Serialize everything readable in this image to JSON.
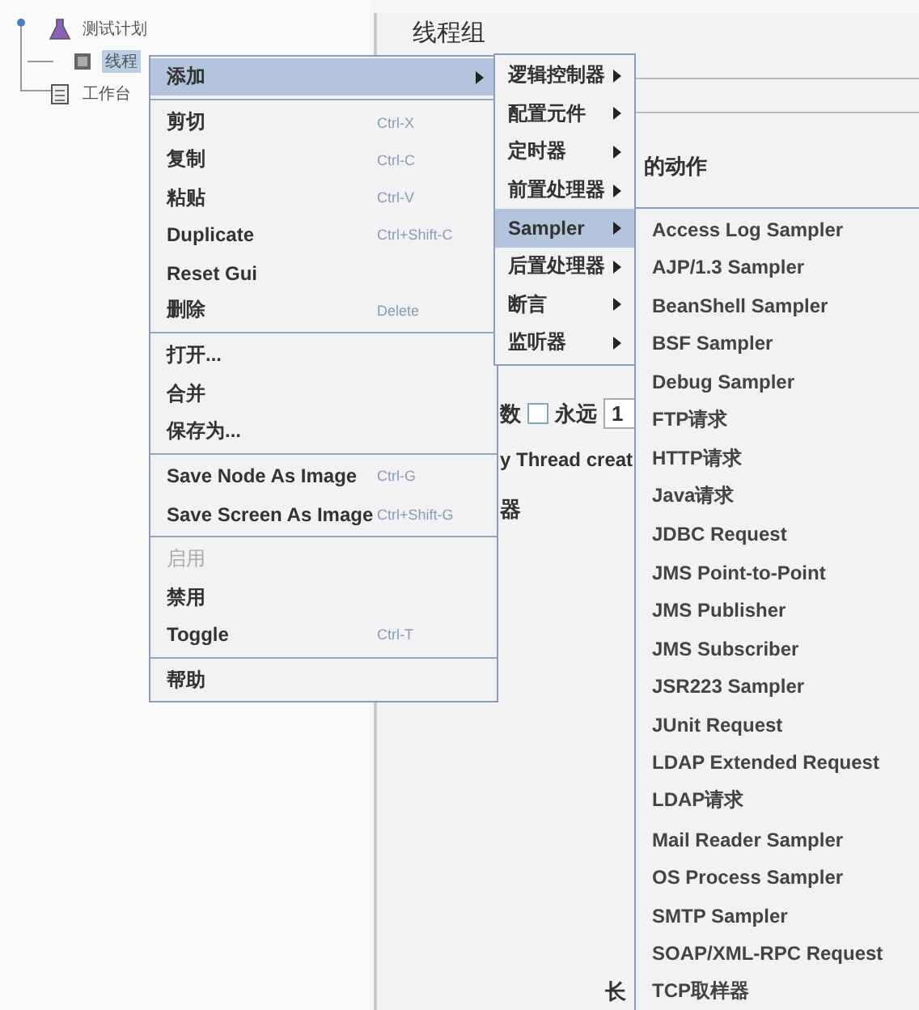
{
  "tree": {
    "items": [
      {
        "label": "测试计划",
        "selected": false,
        "children": [
          {
            "label": "线程",
            "selected": true
          }
        ]
      },
      {
        "label": "工作台",
        "selected": false
      }
    ]
  },
  "panel": {
    "title": "线程组",
    "section_label": "的动作",
    "loop_label": "数",
    "forever": {
      "label": "永远",
      "checked": false
    },
    "loop_value": "1",
    "thread_label": "y Thread creat",
    "scheduler_label": "器",
    "bottom_label": "长"
  },
  "context_menu": {
    "groups": [
      [
        {
          "label": "添加",
          "submenu": true,
          "selected": true,
          "disabled": false
        }
      ],
      [
        {
          "label": "剪切",
          "shortcut": "Ctrl-X",
          "submenu": false,
          "selected": false,
          "disabled": false
        },
        {
          "label": "复制",
          "shortcut": "Ctrl-C",
          "submenu": false,
          "selected": false,
          "disabled": false
        },
        {
          "label": "粘贴",
          "shortcut": "Ctrl-V",
          "submenu": false,
          "selected": false,
          "disabled": false
        },
        {
          "label": "Duplicate",
          "shortcut": "Ctrl+Shift-C",
          "submenu": false,
          "selected": false,
          "disabled": false
        },
        {
          "label": "Reset Gui",
          "submenu": false,
          "selected": false,
          "disabled": false
        },
        {
          "label": "删除",
          "shortcut": "Delete",
          "submenu": false,
          "selected": false,
          "disabled": false
        }
      ],
      [
        {
          "label": "打开...",
          "submenu": false,
          "selected": false,
          "disabled": false
        },
        {
          "label": "合并",
          "submenu": false,
          "selected": false,
          "disabled": false
        },
        {
          "label": "保存为...",
          "submenu": false,
          "selected": false,
          "disabled": false
        }
      ],
      [
        {
          "label": "Save Node As Image",
          "shortcut": "Ctrl-G",
          "submenu": false,
          "selected": false,
          "disabled": false
        },
        {
          "label": "Save Screen As Image",
          "shortcut": "Ctrl+Shift-G",
          "submenu": false,
          "selected": false,
          "disabled": false
        }
      ],
      [
        {
          "label": "启用",
          "submenu": false,
          "selected": false,
          "disabled": true
        },
        {
          "label": "禁用",
          "submenu": false,
          "selected": false,
          "disabled": false
        },
        {
          "label": "Toggle",
          "shortcut": "Ctrl-T",
          "submenu": false,
          "selected": false,
          "disabled": false
        }
      ],
      [
        {
          "label": "帮助",
          "submenu": false,
          "selected": false,
          "disabled": false
        }
      ]
    ]
  },
  "add_submenu": {
    "items": [
      {
        "label": "逻辑控制器",
        "selected": false
      },
      {
        "label": "配置元件",
        "selected": false
      },
      {
        "label": "定时器",
        "selected": false
      },
      {
        "label": "前置处理器",
        "selected": false
      },
      {
        "label": "Sampler",
        "selected": true
      },
      {
        "label": "后置处理器",
        "selected": false
      },
      {
        "label": "断言",
        "selected": false
      },
      {
        "label": "监听器",
        "selected": false
      }
    ]
  },
  "sampler_submenu": {
    "items": [
      "Access Log Sampler",
      "AJP/1.3 Sampler",
      "BeanShell Sampler",
      "BSF Sampler",
      "Debug Sampler",
      "FTP请求",
      "HTTP请求",
      "Java请求",
      "JDBC Request",
      "JMS Point-to-Point",
      "JMS Publisher",
      "JMS Subscriber",
      "JSR223 Sampler",
      "JUnit Request",
      "LDAP Extended Request",
      "LDAP请求",
      "Mail Reader Sampler",
      "OS Process Sampler",
      "SMTP Sampler",
      "SOAP/XML-RPC Request",
      "TCP取样器"
    ]
  }
}
